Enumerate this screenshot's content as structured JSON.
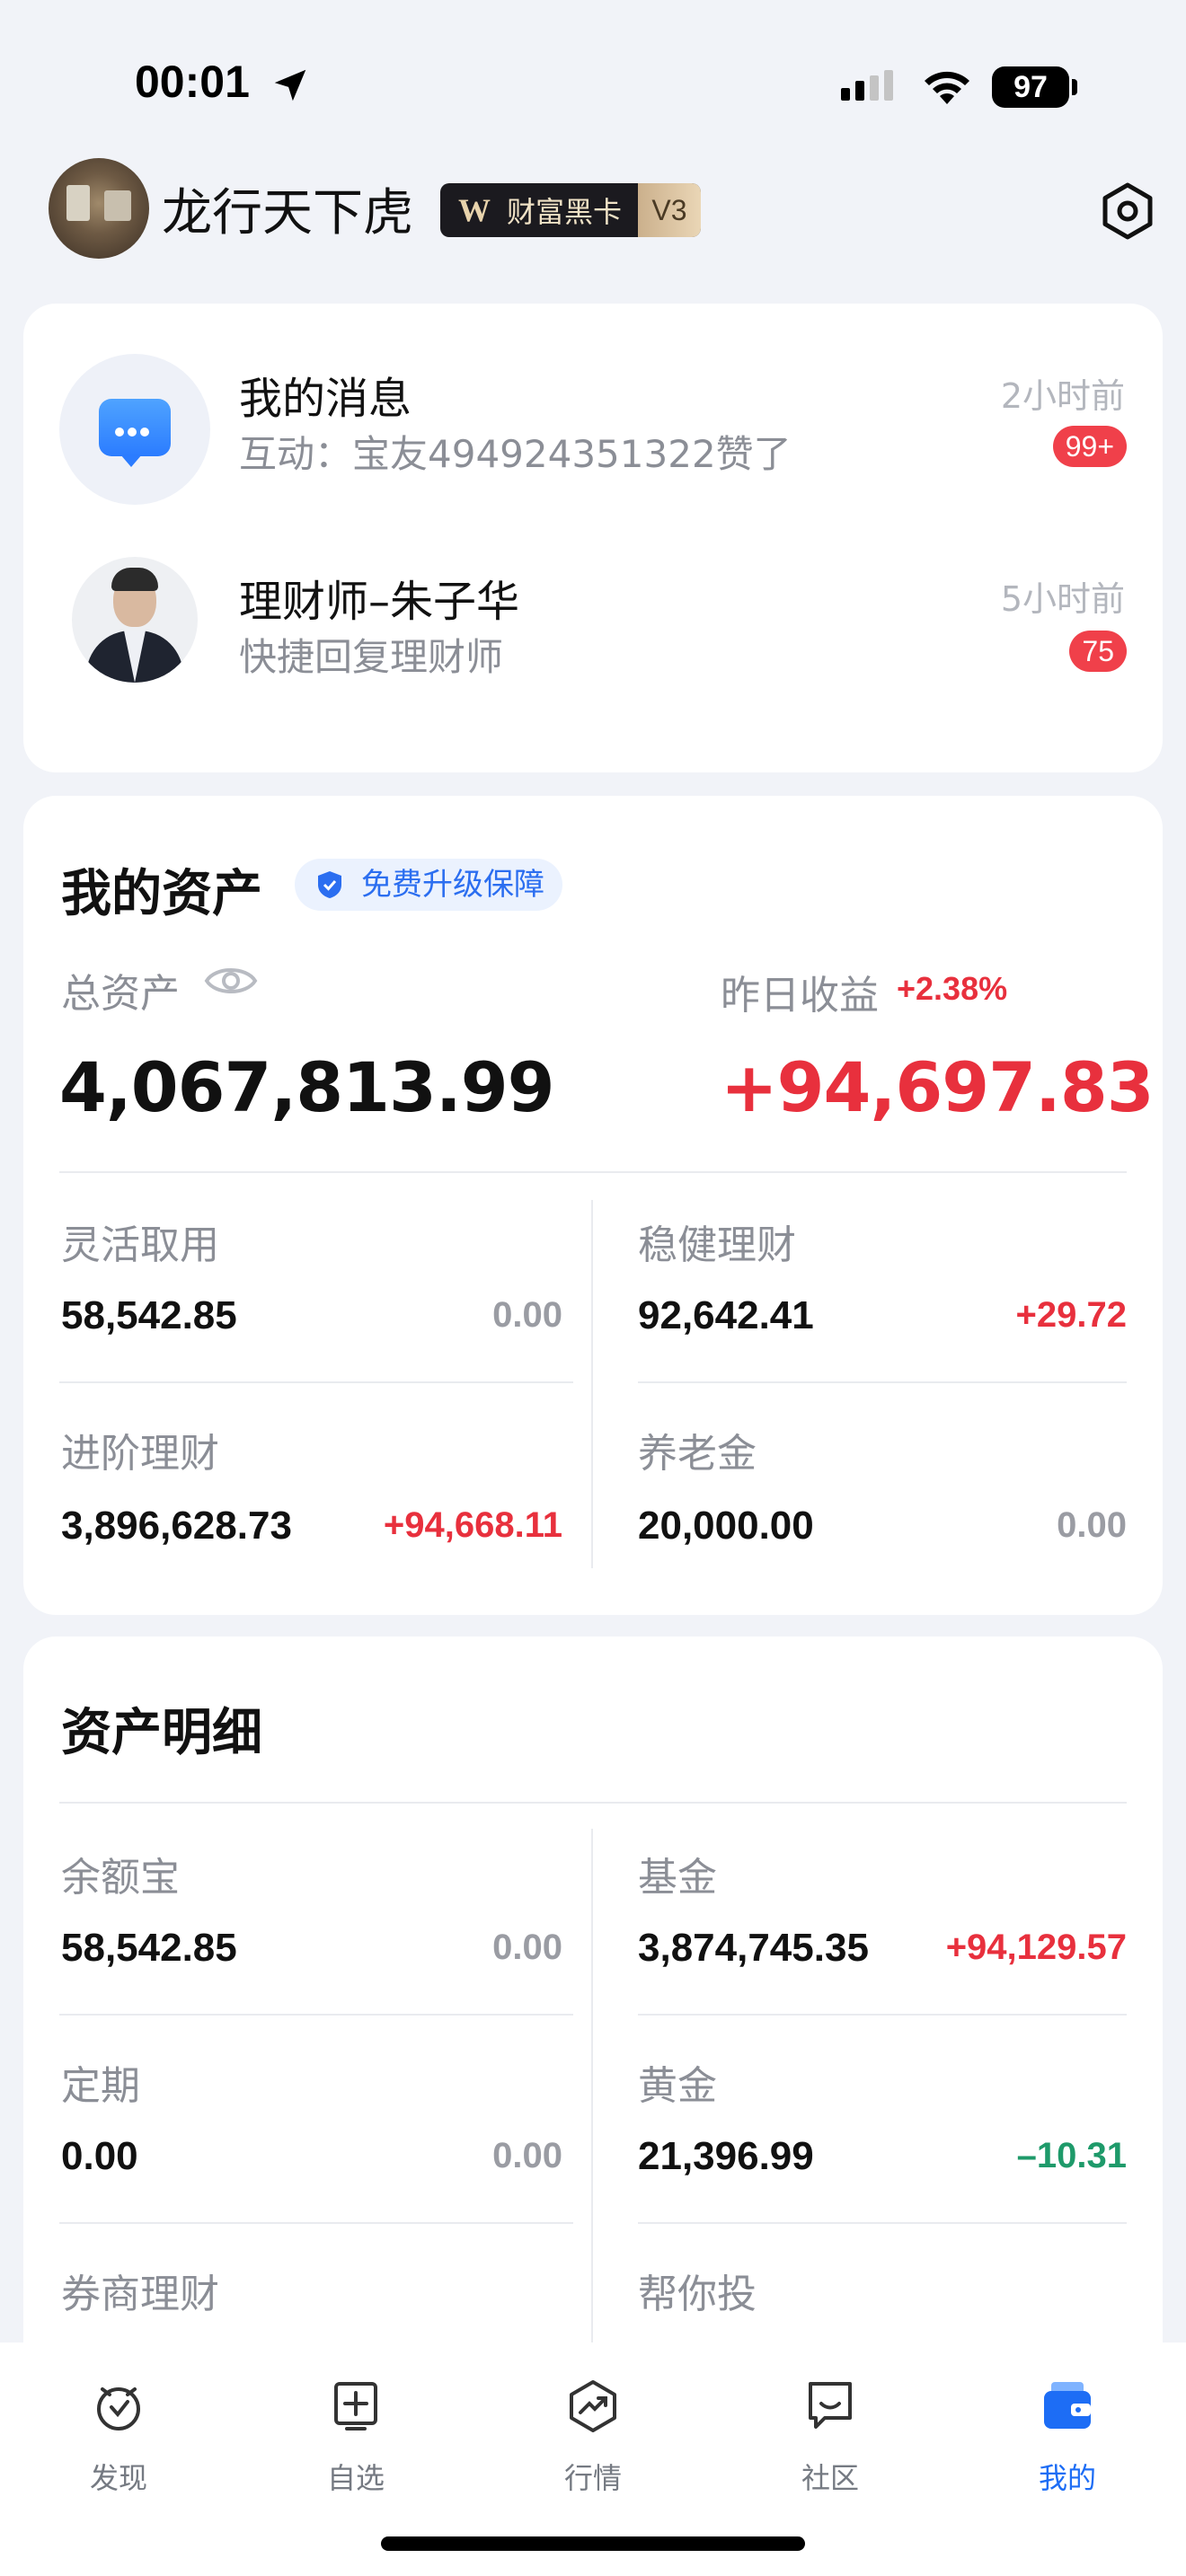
{
  "status_bar": {
    "time": "00:01",
    "battery": "97"
  },
  "header": {
    "username": "龙行天下虎",
    "vip_label": "财富黑卡",
    "vip_level": "V3"
  },
  "messages": [
    {
      "title": "我的消息",
      "subtitle": "互动：宝友494924351322赞了",
      "time": "2小时前",
      "badge": "99+"
    },
    {
      "title": "理财师–朱子华",
      "subtitle": "快捷回复理财师",
      "time": "5小时前",
      "badge": "75"
    }
  ],
  "assets": {
    "title": "我的资产",
    "guarantee_label": "免费升级保障",
    "total_label": "总资产",
    "total_value": "4,067,813.99",
    "yesterday_label": "昨日收益",
    "yesterday_pct": "+2.38%",
    "yesterday_value": "+94,697.83",
    "cells": [
      {
        "label": "灵活取用",
        "value": "58,542.85",
        "change": "0.00"
      },
      {
        "label": "稳健理财",
        "value": "92,642.41",
        "change": "+29.72"
      },
      {
        "label": "进阶理财",
        "value": "3,896,628.73",
        "change": "+94,668.11"
      },
      {
        "label": "养老金",
        "value": "20,000.00",
        "change": "0.00"
      }
    ]
  },
  "detail": {
    "title": "资产明细",
    "cells": [
      {
        "label": "余额宝",
        "value": "58,542.85",
        "change": "0.00"
      },
      {
        "label": "基金",
        "value": "3,874,745.35",
        "change": "+94,129.57"
      },
      {
        "label": "定期",
        "value": "0.00",
        "change": "0.00"
      },
      {
        "label": "黄金",
        "value": "21,396.99",
        "change": "–10.31"
      },
      {
        "label": "券商理财"
      },
      {
        "label": "帮你投"
      }
    ]
  },
  "tabs": [
    {
      "label": "发现",
      "icon": "discover-icon"
    },
    {
      "label": "自选",
      "icon": "watchlist-icon"
    },
    {
      "label": "行情",
      "icon": "market-icon"
    },
    {
      "label": "社区",
      "icon": "community-icon"
    },
    {
      "label": "我的",
      "icon": "wallet-icon",
      "active": true
    }
  ],
  "colors": {
    "accent": "#1d6df5",
    "gain": "#e8303d",
    "loss": "#1e9a6a",
    "badge": "#f0404a"
  }
}
